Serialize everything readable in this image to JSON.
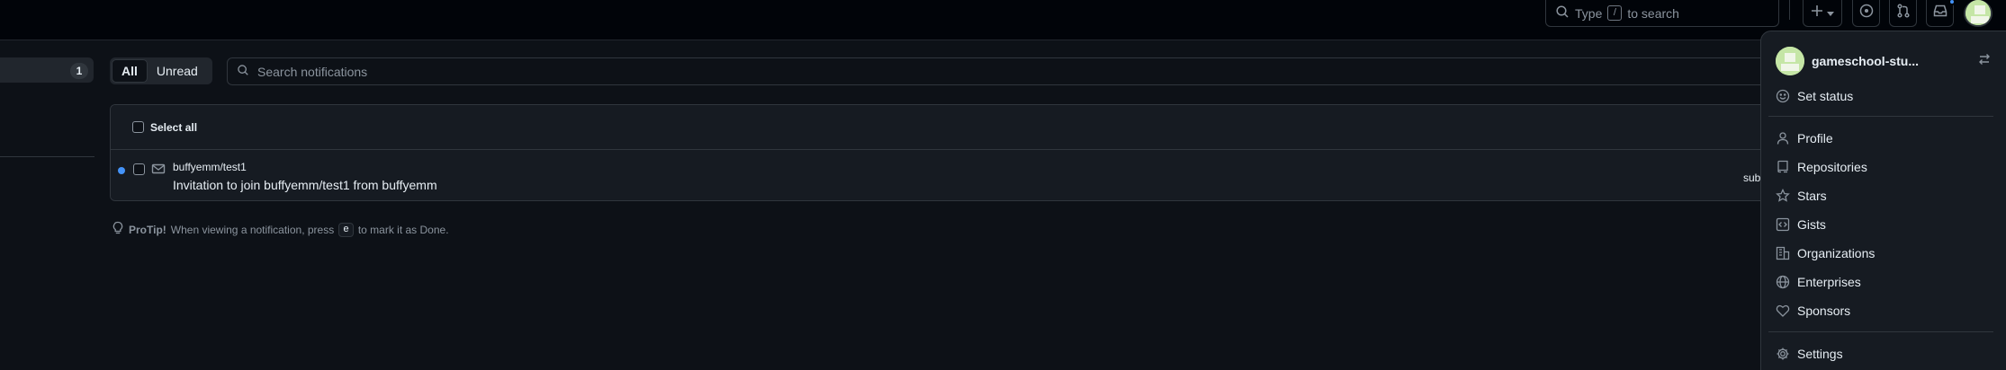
{
  "header": {
    "search_prefix": "Type",
    "search_key": "/",
    "search_suffix": "to search",
    "icons": [
      "search-icon",
      "plus-icon",
      "triangle-down-icon",
      "issue-opened-icon",
      "git-pull-request-icon",
      "inbox-icon"
    ]
  },
  "sidebar": {
    "inbox_count": "1"
  },
  "filters": {
    "tabs": [
      {
        "label": "All",
        "active": true
      },
      {
        "label": "Unread",
        "active": false
      }
    ],
    "search_placeholder": "Search notifications"
  },
  "list": {
    "select_all_label": "Select all",
    "items": [
      {
        "repo": "buffyemm/test1",
        "title": "Invitation to join buffyemm/test1 from buffyemm",
        "reason": "sub",
        "unread": true,
        "icon": "mail-icon"
      }
    ]
  },
  "protip": {
    "label": "ProTip!",
    "text_before": "When viewing a notification, press",
    "key": "e",
    "text_after": "to mark it as Done."
  },
  "account_menu": {
    "username": "gameschool-stu...",
    "items": [
      {
        "label": "Set status",
        "icon": "smiley-icon"
      },
      {
        "label": "Profile",
        "icon": "person-icon"
      },
      {
        "label": "Repositories",
        "icon": "repo-icon"
      },
      {
        "label": "Stars",
        "icon": "star-icon"
      },
      {
        "label": "Gists",
        "icon": "code-square-icon"
      },
      {
        "label": "Organizations",
        "icon": "organization-icon"
      },
      {
        "label": "Enterprises",
        "icon": "globe-icon"
      },
      {
        "label": "Sponsors",
        "icon": "heart-icon"
      },
      {
        "label": "Settings",
        "icon": "gear-icon"
      }
    ]
  },
  "colors": {
    "background": "#0d1117",
    "header_background": "#010409",
    "surface": "#161b22",
    "border": "#30363d",
    "accent_blue": "#4493f8",
    "avatar_green": "#c5e6a6"
  }
}
